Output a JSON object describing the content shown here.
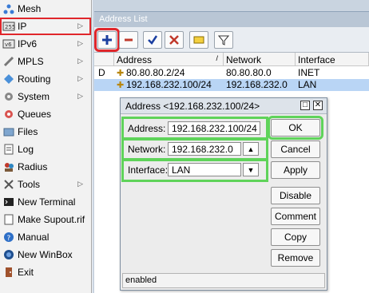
{
  "sidebar": {
    "items": [
      {
        "label": "Mesh",
        "icon": "mesh-icon",
        "submenu": false
      },
      {
        "label": "IP",
        "icon": "ip-icon",
        "submenu": true
      },
      {
        "label": "IPv6",
        "icon": "ipv6-icon",
        "submenu": true
      },
      {
        "label": "MPLS",
        "icon": "mpls-icon",
        "submenu": true
      },
      {
        "label": "Routing",
        "icon": "routing-icon",
        "submenu": true
      },
      {
        "label": "System",
        "icon": "system-icon",
        "submenu": true
      },
      {
        "label": "Queues",
        "icon": "queues-icon",
        "submenu": false
      },
      {
        "label": "Files",
        "icon": "files-icon",
        "submenu": false
      },
      {
        "label": "Log",
        "icon": "log-icon",
        "submenu": false
      },
      {
        "label": "Radius",
        "icon": "radius-icon",
        "submenu": false
      },
      {
        "label": "Tools",
        "icon": "tools-icon",
        "submenu": true
      },
      {
        "label": "New Terminal",
        "icon": "terminal-icon",
        "submenu": false
      },
      {
        "label": "Make Supout.rif",
        "icon": "supout-icon",
        "submenu": false
      },
      {
        "label": "Manual",
        "icon": "manual-icon",
        "submenu": false
      },
      {
        "label": "New WinBox",
        "icon": "winbox-icon",
        "submenu": false
      },
      {
        "label": "Exit",
        "icon": "exit-icon",
        "submenu": false
      }
    ]
  },
  "window": {
    "title": "Address List"
  },
  "toolbar": {
    "buttons": [
      "add-icon",
      "remove-icon",
      "enable-icon",
      "disable-icon",
      "comment-icon",
      "filter-icon"
    ]
  },
  "table": {
    "columns": [
      "Address",
      "Network",
      "Interface"
    ],
    "rows": [
      {
        "flag": "D",
        "address": "80.80.80.2/24",
        "network": "80.80.80.0",
        "interface": "INET",
        "selected": false
      },
      {
        "flag": "",
        "address": "192.168.232.100/24",
        "network": "192.168.232.0",
        "interface": "LAN",
        "selected": true
      }
    ]
  },
  "dialog": {
    "title": "Address <192.168.232.100/24>",
    "address_label": "Address:",
    "address_value": "192.168.232.100/24",
    "network_label": "Network:",
    "network_value": "192.168.232.0",
    "interface_label": "Interface:",
    "interface_value": "LAN",
    "buttons": {
      "ok": "OK",
      "cancel": "Cancel",
      "apply": "Apply",
      "disable": "Disable",
      "comment": "Comment",
      "copy": "Copy",
      "remove": "Remove"
    },
    "status": "enabled"
  },
  "colors": {
    "highlight_red": "#e0262b",
    "highlight_green": "#5fd35a",
    "selection": "#b9d5f5"
  }
}
